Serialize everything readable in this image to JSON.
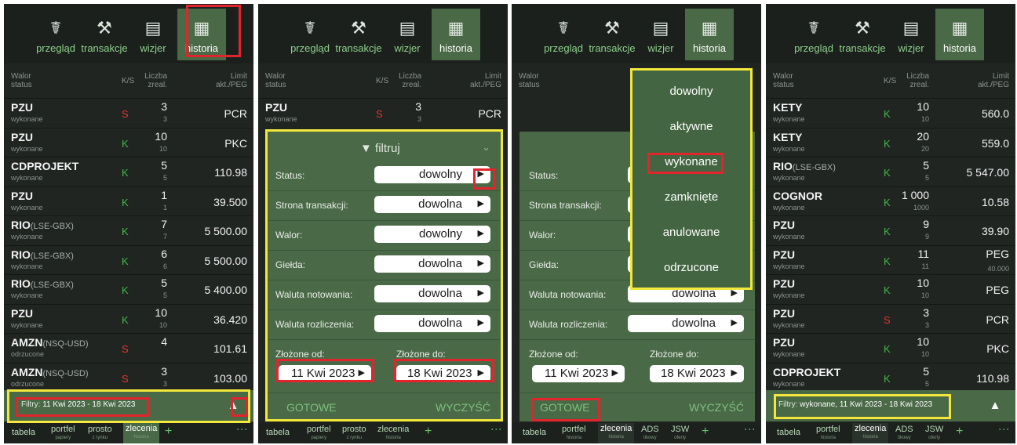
{
  "tabs": [
    {
      "label": "przegląd",
      "icon": "handshake-icon"
    },
    {
      "label": "transakcje",
      "icon": "gavel-icon"
    },
    {
      "label": "wizjer",
      "icon": "watch-document-icon"
    },
    {
      "label": "historia",
      "icon": "calendar-icon"
    }
  ],
  "header": {
    "walor": "Walor",
    "status": "status",
    "ks": "K/S",
    "liczba": "Liczba",
    "zreal": "zreal.",
    "limit": "Limit",
    "aktpeg": "akt./PEG"
  },
  "panel1": {
    "rows": [
      {
        "name": "PZU",
        "tag": "",
        "status": "wykonane",
        "ks": "S",
        "q": "3",
        "q2": "3",
        "lim": "PCR",
        "lim2": ""
      },
      {
        "name": "PZU",
        "tag": "",
        "status": "wykonane",
        "ks": "K",
        "q": "10",
        "q2": "10",
        "lim": "PKC",
        "lim2": ""
      },
      {
        "name": "CDPROJEKT",
        "tag": "",
        "status": "wykonane",
        "ks": "K",
        "q": "5",
        "q2": "5",
        "lim": "110.98",
        "lim2": ""
      },
      {
        "name": "PZU",
        "tag": "",
        "status": "wykonane",
        "ks": "K",
        "q": "1",
        "q2": "1",
        "lim": "39.500",
        "lim2": ""
      },
      {
        "name": "RIO",
        "tag": "(LSE-GBX)",
        "status": "wykonane",
        "ks": "K",
        "q": "7",
        "q2": "7",
        "lim": "5 500.00",
        "lim2": ""
      },
      {
        "name": "RIO",
        "tag": "(LSE-GBX)",
        "status": "wykonane",
        "ks": "K",
        "q": "6",
        "q2": "6",
        "lim": "5 500.00",
        "lim2": ""
      },
      {
        "name": "RIO",
        "tag": "(LSE-GBX)",
        "status": "wykonane",
        "ks": "K",
        "q": "5",
        "q2": "5",
        "lim": "5 400.00",
        "lim2": ""
      },
      {
        "name": "PZU",
        "tag": "",
        "status": "wykonane",
        "ks": "K",
        "q": "10",
        "q2": "10",
        "lim": "36.420",
        "lim2": ""
      },
      {
        "name": "AMZN",
        "tag": "(NSQ-USD)",
        "status": "odrzucone",
        "ks": "S",
        "q": "4",
        "q2": "",
        "lim": "101.61",
        "lim2": ""
      },
      {
        "name": "AMZN",
        "tag": "(NSQ-USD)",
        "status": "odrzucone",
        "ks": "S",
        "q": "3",
        "q2": "3",
        "lim": "103.00",
        "lim2": ""
      }
    ]
  },
  "panel1_filter": {
    "label": "Filtry:",
    "value": "11 Kwi 2023 - 18 Kwi 2023"
  },
  "panel4_filter": {
    "label": "Filtry:",
    "value": "wykonane, 11 Kwi 2023 - 18 Kwi 2023"
  },
  "bottom_a": {
    "tabela": "tabela",
    "portfel": "portfel",
    "portfel_sub": "papiery",
    "prosto": "prosto",
    "prosto_sub": "z rynku",
    "zlecenia": "zlecenia",
    "zlecenia_sub": "historia",
    "plus": "+"
  },
  "bottom_b": {
    "tabela": "tabela",
    "portfel": "portfel",
    "portfel_sub": "historia",
    "zlecenia": "zlecenia",
    "zlecenia_sub": "historia",
    "ads": "ADS",
    "ads_sub": "tikowy",
    "jsw": "JSW",
    "jsw_sub": "oferty",
    "plus": "+"
  },
  "panel2": {
    "row0": {
      "name": "PZU",
      "status": "wykonane",
      "ks": "S",
      "q": "3",
      "q2": "3",
      "lim": "PCR"
    }
  },
  "filter": {
    "title": "filtruj",
    "fields": [
      {
        "label": "Status:",
        "value": "dowolny"
      },
      {
        "label": "Strona transakcji:",
        "value": "dowolna"
      },
      {
        "label": "Walor:",
        "value": "dowolny"
      },
      {
        "label": "Giełda:",
        "value": "dowolna"
      },
      {
        "label": "Waluta notowania:",
        "value": "dowolna"
      },
      {
        "label": "Waluta rozliczenia:",
        "value": "dowolna"
      }
    ],
    "from_label": "Złożone od:",
    "to_label": "Złożone do:",
    "from": "11 Kwi 2023",
    "to": "18 Kwi 2023",
    "gotowe": "GOTOWE",
    "wyczysc": "WYCZYŚĆ"
  },
  "dropdown": {
    "options": [
      "dowolny",
      "aktywne",
      "wykonane",
      "zamknięte",
      "anulowane",
      "odrzucone"
    ]
  },
  "panel4": {
    "rows": [
      {
        "name": "KETY",
        "tag": "",
        "status": "wykonane",
        "ks": "K",
        "q": "10",
        "q2": "10",
        "lim": "560.0",
        "lim2": ""
      },
      {
        "name": "KETY",
        "tag": "",
        "status": "wykonane",
        "ks": "K",
        "q": "20",
        "q2": "20",
        "lim": "559.0",
        "lim2": ""
      },
      {
        "name": "RIO",
        "tag": "(LSE-GBX)",
        "status": "wykonane",
        "ks": "K",
        "q": "5",
        "q2": "5",
        "lim": "5 547.00",
        "lim2": ""
      },
      {
        "name": "COGNOR",
        "tag": "",
        "status": "wykonane",
        "ks": "K",
        "q": "1 000",
        "q2": "1000",
        "lim": "10.58",
        "lim2": ""
      },
      {
        "name": "PZU",
        "tag": "",
        "status": "wykonane",
        "ks": "K",
        "q": "9",
        "q2": "9",
        "lim": "39.90",
        "lim2": ""
      },
      {
        "name": "PZU",
        "tag": "",
        "status": "wykonane",
        "ks": "K",
        "q": "11",
        "q2": "11",
        "lim": "PEG",
        "lim2": "40.000"
      },
      {
        "name": "PZU",
        "tag": "",
        "status": "wykonane",
        "ks": "K",
        "q": "10",
        "q2": "10",
        "lim": "PEG",
        "lim2": ""
      },
      {
        "name": "PZU",
        "tag": "",
        "status": "wykonane",
        "ks": "S",
        "q": "3",
        "q2": "3",
        "lim": "PCR",
        "lim2": ""
      },
      {
        "name": "PZU",
        "tag": "",
        "status": "wykonane",
        "ks": "K",
        "q": "10",
        "q2": "10",
        "lim": "PKC",
        "lim2": ""
      },
      {
        "name": "CDPROJEKT",
        "tag": "",
        "status": "wykonane",
        "ks": "K",
        "q": "5",
        "q2": "5",
        "lim": "110.98",
        "lim2": ""
      }
    ]
  }
}
